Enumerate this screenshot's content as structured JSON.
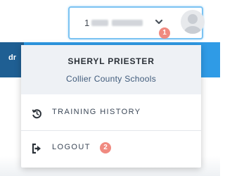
{
  "header": {
    "left_tab_text": "dr"
  },
  "user_menu": {
    "masked_name_prefix": "1",
    "profile_name": "SHERYL PRIESTER",
    "organization": "Collier County Schools",
    "trigger_badge": "1",
    "items": [
      {
        "label": "TRAINING HISTORY",
        "icon": "history-icon"
      },
      {
        "label": "LOGOUT",
        "icon": "logout-icon",
        "badge": "2"
      }
    ]
  },
  "colors": {
    "header_blue": "#2f9be6",
    "header_dark": "#1f5f93",
    "trigger_border": "#7cc3f2",
    "badge": "#f08a80",
    "profile_bg": "#eef1f5",
    "org_text": "#3f5a7a"
  }
}
